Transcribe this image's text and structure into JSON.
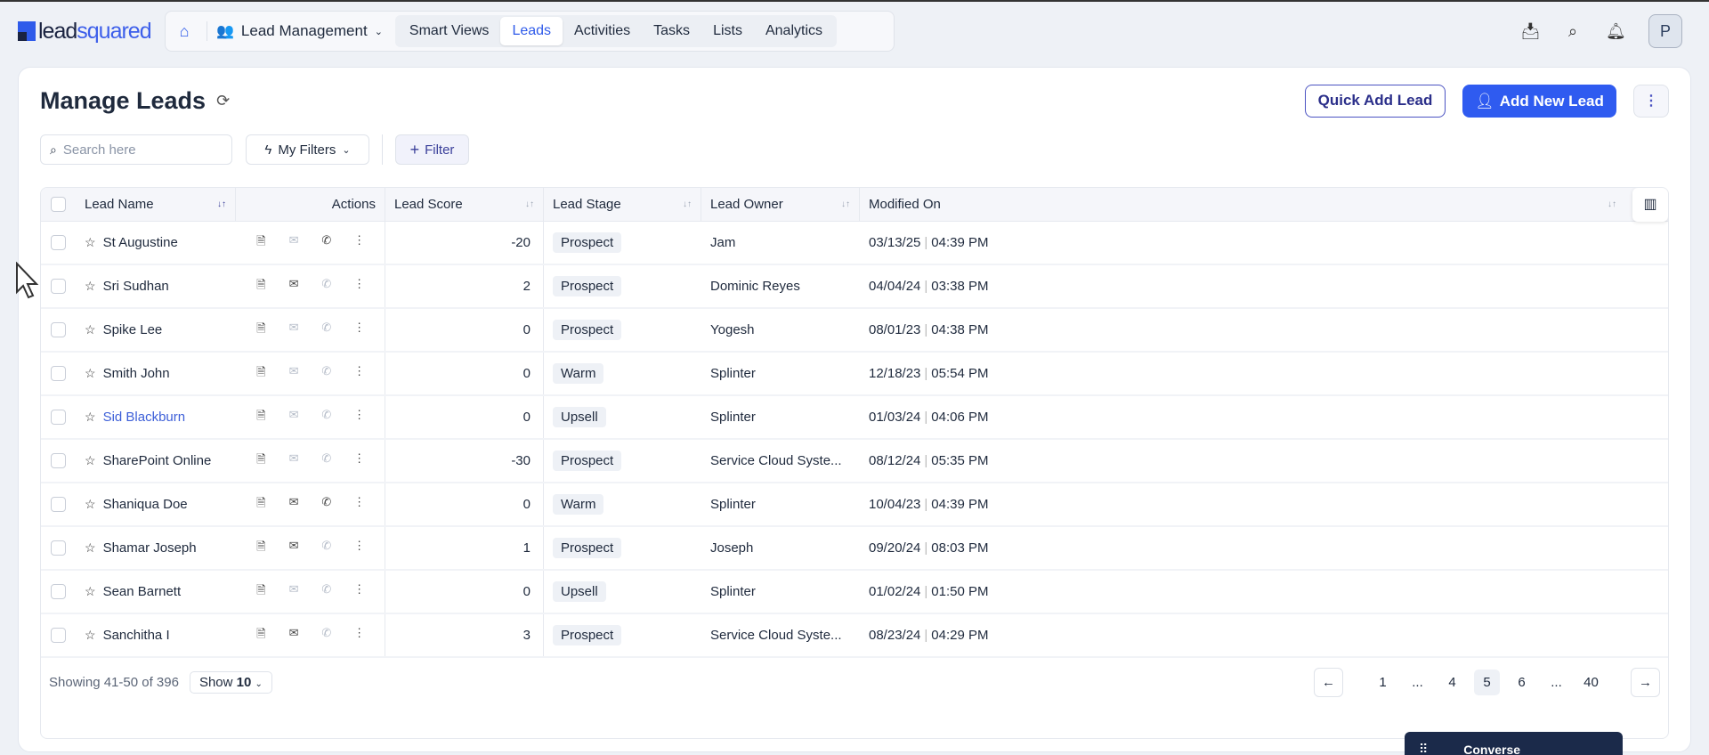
{
  "brand": {
    "part1": "lead",
    "part2": "squared"
  },
  "nav": {
    "module": "Lead Management",
    "tabs": [
      "Smart Views",
      "Leads",
      "Activities",
      "Tasks",
      "Lists",
      "Analytics"
    ],
    "active_tab": "Leads"
  },
  "user": {
    "initial": "P"
  },
  "page": {
    "title": "Manage Leads",
    "quick_add": "Quick Add Lead",
    "add_new": "Add New Lead"
  },
  "toolbar": {
    "search_placeholder": "Search here",
    "my_filters": "My Filters",
    "filter": "Filter"
  },
  "table": {
    "columns": [
      "Lead Name",
      "Actions",
      "Lead Score",
      "Lead Stage",
      "Lead Owner",
      "Modified On"
    ],
    "rows": [
      {
        "name": "St Augustine",
        "score": "-20",
        "stage": "Prospect",
        "owner": "Jam",
        "date": "03/13/25",
        "time": "04:39 PM",
        "email": false,
        "phone": true,
        "link": false
      },
      {
        "name": "Sri Sudhan",
        "score": "2",
        "stage": "Prospect",
        "owner": "Dominic Reyes",
        "date": "04/04/24",
        "time": "03:38 PM",
        "email": true,
        "phone": false,
        "link": false
      },
      {
        "name": "Spike Lee",
        "score": "0",
        "stage": "Prospect",
        "owner": "Yogesh",
        "date": "08/01/23",
        "time": "04:38 PM",
        "email": false,
        "phone": false,
        "link": false
      },
      {
        "name": "Smith John",
        "score": "0",
        "stage": "Warm",
        "owner": "Splinter",
        "date": "12/18/23",
        "time": "05:54 PM",
        "email": false,
        "phone": false,
        "link": false
      },
      {
        "name": "Sid Blackburn",
        "score": "0",
        "stage": "Upsell",
        "owner": "Splinter",
        "date": "01/03/24",
        "time": "04:06 PM",
        "email": false,
        "phone": false,
        "link": true
      },
      {
        "name": "SharePoint Online",
        "score": "-30",
        "stage": "Prospect",
        "owner": "Service Cloud Syste...",
        "date": "08/12/24",
        "time": "05:35 PM",
        "email": false,
        "phone": false,
        "link": false
      },
      {
        "name": "Shaniqua Doe",
        "score": "0",
        "stage": "Warm",
        "owner": "Splinter",
        "date": "10/04/23",
        "time": "04:39 PM",
        "email": true,
        "phone": true,
        "link": false
      },
      {
        "name": "Shamar Joseph",
        "score": "1",
        "stage": "Prospect",
        "owner": "Joseph",
        "date": "09/20/24",
        "time": "08:03 PM",
        "email": true,
        "phone": false,
        "link": false
      },
      {
        "name": "Sean Barnett",
        "score": "0",
        "stage": "Upsell",
        "owner": "Splinter",
        "date": "01/02/24",
        "time": "01:50 PM",
        "email": false,
        "phone": false,
        "link": false
      },
      {
        "name": "Sanchitha I",
        "score": "3",
        "stage": "Prospect",
        "owner": "Service Cloud Syste...",
        "date": "08/23/24",
        "time": "04:29 PM",
        "email": true,
        "phone": false,
        "link": false
      }
    ]
  },
  "footer": {
    "showing": "Showing 41-50 of 396",
    "show_label": "Show",
    "show_value": "10",
    "pages": [
      "1",
      "...",
      "4",
      "5",
      "6",
      "...",
      "40"
    ],
    "current_page": "5"
  },
  "widget": {
    "label": "Converse"
  }
}
